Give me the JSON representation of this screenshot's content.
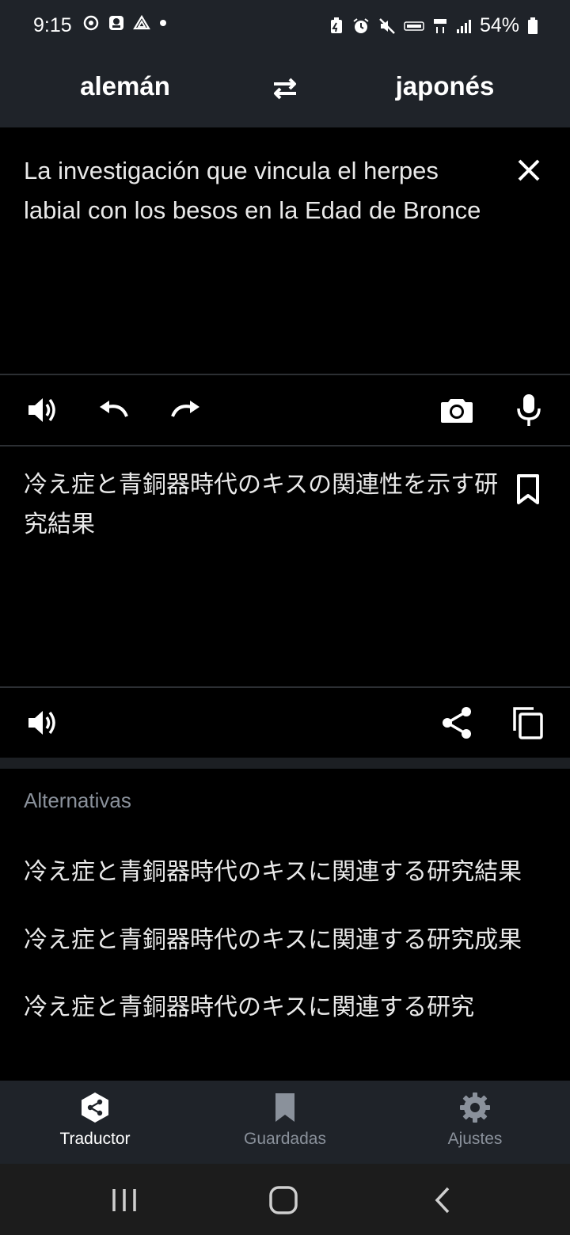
{
  "status_bar": {
    "time": "9:15",
    "battery_percent": "54%"
  },
  "languages": {
    "source": "alemán",
    "target": "japonés"
  },
  "source": {
    "text": "La investigación que vincula el herpes labial con los besos en la Edad de Bronce"
  },
  "translation": {
    "text": "冷え症と青銅器時代のキスの関連性を示す研究結果"
  },
  "alternatives": {
    "title": "Alternativas",
    "items": [
      "冷え症と青銅器時代のキスに関連する研究結果",
      "冷え症と青銅器時代のキスに関連する研究成果",
      "冷え症と青銅器時代のキスに関連する研究"
    ]
  },
  "bottom_nav": {
    "items": [
      {
        "label": "Traductor",
        "icon": "translator-icon",
        "active": true
      },
      {
        "label": "Guardadas",
        "icon": "bookmark-icon",
        "active": false
      },
      {
        "label": "Ajustes",
        "icon": "gear-icon",
        "active": false
      }
    ]
  },
  "colors": {
    "header_bg": "#1f2329",
    "content_bg": "#000000",
    "muted_text": "#8a919b",
    "primary_text": "#e9e9e9"
  }
}
